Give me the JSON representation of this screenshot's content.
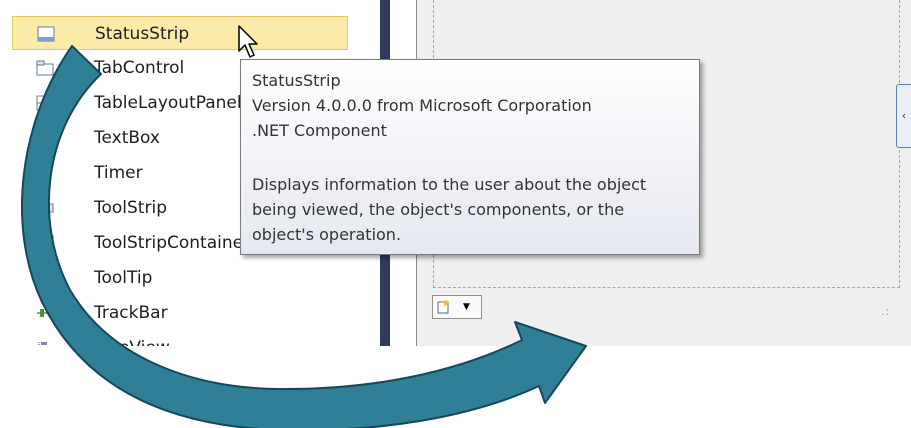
{
  "toolbox": {
    "items": [
      {
        "label": "StatusStrip",
        "icon": "statusstrip-icon",
        "selected": true
      },
      {
        "label": "TabControl",
        "icon": "tabcontrol-icon"
      },
      {
        "label": "TableLayoutPanel",
        "icon": "tablelayoutpanel-icon"
      },
      {
        "label": "TextBox",
        "icon": "textbox-icon"
      },
      {
        "label": "Timer",
        "icon": "timer-icon"
      },
      {
        "label": "ToolStrip",
        "icon": "toolstrip-icon"
      },
      {
        "label": "ToolStripContainer",
        "icon": "toolstripcontainer-icon"
      },
      {
        "label": "ToolTip",
        "icon": "tooltip-icon"
      },
      {
        "label": "TrackBar",
        "icon": "trackbar-icon"
      },
      {
        "label": "TreeView",
        "icon": "treeview-icon"
      }
    ]
  },
  "tooltip": {
    "title": "StatusStrip",
    "version": "Version 4.0.0.0 from Microsoft Corporation",
    "kind": ".NET Component",
    "description_lines": [
      "Displays information to the user about the object",
      "being viewed, the object's components, or the",
      "object's operation."
    ]
  },
  "designer": {
    "side_tab_glyph": "‹",
    "tray_arrow_glyph": "▼",
    "grip_glyph": ".:"
  },
  "colors": {
    "selection_fill": "#fbeaa8",
    "arrow_fill": "#2f7f97",
    "splitter": "#2f3a5e"
  }
}
